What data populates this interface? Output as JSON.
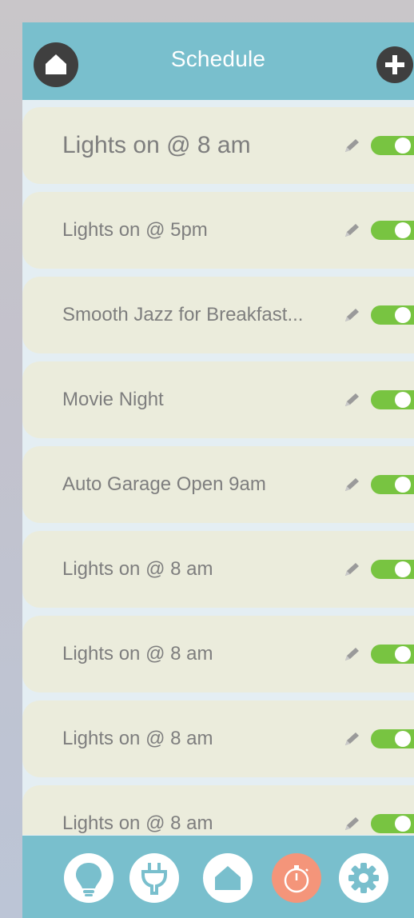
{
  "header": {
    "title": "Schedule"
  },
  "schedules": [
    {
      "label": "Lights on @ 8 am",
      "enabled": true
    },
    {
      "label": "Lights on @ 5pm",
      "enabled": true
    },
    {
      "label": "Smooth Jazz for Breakfast...",
      "enabled": true
    },
    {
      "label": "Movie Night",
      "enabled": true
    },
    {
      "label": "Auto Garage Open 9am",
      "enabled": true
    },
    {
      "label": "Lights on @ 8 am",
      "enabled": true
    },
    {
      "label": "Lights on @ 8 am",
      "enabled": true
    },
    {
      "label": "Lights on @ 8 am",
      "enabled": true
    },
    {
      "label": "Lights on @ 8 am",
      "enabled": true
    }
  ],
  "icons": {
    "header_left": "home-icon",
    "header_right": "plus-icon",
    "row_edit": "pencil-icon",
    "row_toggle": "toggle-switch",
    "nav": [
      "lightbulb-icon",
      "plug-icon",
      "home-icon",
      "stopwatch-icon",
      "gear-icon"
    ]
  },
  "colors": {
    "header": "#79bfcd",
    "row": "#ebecdc",
    "toggle_on": "#78c441",
    "active_nav": "#f4957a",
    "list_bg": "#e4eef3"
  },
  "active_nav": "stopwatch-icon"
}
